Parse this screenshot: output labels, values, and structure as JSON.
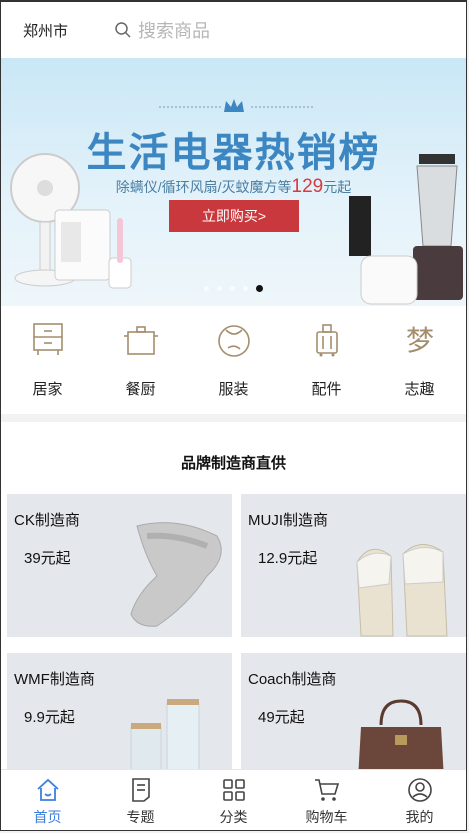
{
  "header": {
    "city": "郑州市",
    "search_placeholder": "搜索商品"
  },
  "banner": {
    "headline": "生活电器热销榜",
    "subtitle_prefix": "除螨仪/循环风扇/灭蚊魔方等",
    "subtitle_price": "129",
    "subtitle_suffix": "元起",
    "button_label": "立即购买>",
    "page_count": 5,
    "active_page": 5
  },
  "categories": [
    {
      "label": "居家",
      "icon": "cabinet-icon"
    },
    {
      "label": "餐厨",
      "icon": "pot-icon"
    },
    {
      "label": "服装",
      "icon": "clothing-icon"
    },
    {
      "label": "配件",
      "icon": "luggage-icon"
    },
    {
      "label": "志趣",
      "icon": "dream-icon"
    }
  ],
  "brand_section": {
    "title": "品牌制造商直供",
    "items": [
      {
        "name": "CK制造商",
        "price": "39元起",
        "image": "socks"
      },
      {
        "name": "MUJI制造商",
        "price": "12.9元起",
        "image": "slippers"
      },
      {
        "name": "WMF制造商",
        "price": "9.9元起",
        "image": "jars"
      },
      {
        "name": "Coach制造商",
        "price": "49元起",
        "image": "bag"
      }
    ]
  },
  "tabbar": {
    "active": "首页",
    "tabs": [
      {
        "label": "首页",
        "icon": "home-icon"
      },
      {
        "label": "专题",
        "icon": "topic-icon"
      },
      {
        "label": "分类",
        "icon": "category-icon"
      },
      {
        "label": "购物车",
        "icon": "cart-icon"
      },
      {
        "label": "我的",
        "icon": "profile-icon"
      }
    ],
    "active_color": "#3a7fe0"
  }
}
